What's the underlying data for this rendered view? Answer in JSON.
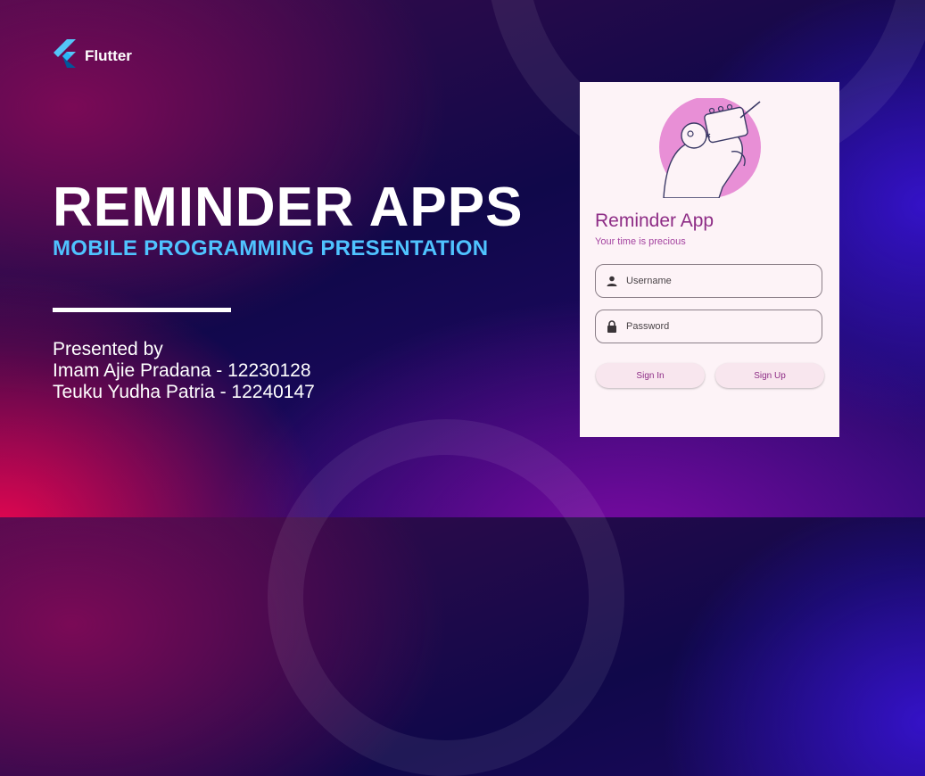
{
  "brand": {
    "name": "Flutter",
    "icon": "flutter-logo-icon"
  },
  "slide": {
    "title": "REMINDER APPS",
    "subtitle": "MOBILE PROGRAMMING PRESENTATION",
    "presented_by": "Presented by",
    "presenters": [
      "Imam Ajie Pradana - 12230128",
      "Teuku Yudha Patria - 12240147"
    ]
  },
  "app_preview": {
    "title": "Reminder App",
    "tagline": "Your time is precious",
    "username_placeholder": "Username",
    "password_placeholder": "Password",
    "signin_label": "Sign In",
    "signup_label": "Sign Up"
  },
  "colors": {
    "subtitle": "#4fc3ff",
    "app_accent": "#8e2d86",
    "app_bg": "#fdf3f7"
  }
}
